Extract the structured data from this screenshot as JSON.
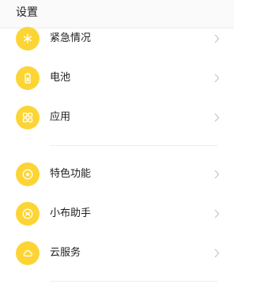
{
  "header": {
    "title": "设置"
  },
  "rows": [
    {
      "label": "紧急情况",
      "icon": "emergency-icon"
    },
    {
      "label": "电池",
      "icon": "battery-icon"
    },
    {
      "label": "应用",
      "icon": "apps-grid-icon"
    },
    {
      "label": "特色功能",
      "icon": "star-icon"
    },
    {
      "label": "小布助手",
      "icon": "assistant-icon"
    },
    {
      "label": "云服务",
      "icon": "cloud-icon"
    }
  ],
  "colors": {
    "accent": "#fcd535",
    "chevron": "#c8c8c8"
  }
}
